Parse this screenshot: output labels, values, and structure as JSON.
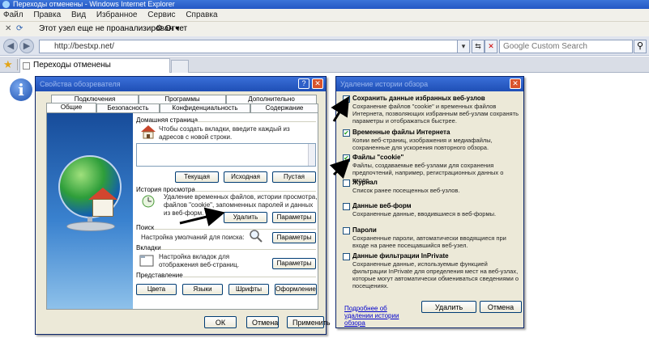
{
  "browser": {
    "window_title": "Переходы отменены - Windows Internet Explorer",
    "menu": [
      "Файл",
      "Правка",
      "Вид",
      "Избранное",
      "Сервис",
      "Справка"
    ],
    "command_bar": {
      "site_label": "Этот узел еще не проанализирован",
      "report_label": "Отчет"
    },
    "address_url": "http://bestxp.net/",
    "search_placeholder": "Google Custom Search",
    "tab_title": "Переходы отменены"
  },
  "options_dialog": {
    "title": "Свойства обозревателя",
    "tabs_row1": [
      "Подключения",
      "Программы",
      "Дополнительно"
    ],
    "tabs_row2": [
      "Общие",
      "Безопасность",
      "Конфиденциальность",
      "Содержание"
    ],
    "home": {
      "label": "Домашняя страница",
      "desc": "Чтобы создать вкладки, введите каждый из адресов с новой строки.",
      "buttons": [
        "Текущая",
        "Исходная",
        "Пустая"
      ]
    },
    "history": {
      "label": "История просмотра",
      "desc": "Удаление временных файлов, истории просмотра, файлов \"cookie\", запомненных паролей и данных из веб-форм.",
      "delete_btn": "Удалить",
      "params_btn": "Параметры"
    },
    "search": {
      "label": "Поиск",
      "desc": "Настройка умолчаний для поиска:",
      "params_btn": "Параметры"
    },
    "tabs_section": {
      "label": "Вкладки",
      "desc": "Настройка вкладок для отображения веб-страниц.",
      "params_btn": "Параметры"
    },
    "appearance": {
      "label": "Представление",
      "buttons": [
        "Цвета",
        "Языки",
        "Шрифты",
        "Оформление"
      ]
    },
    "footer": {
      "ok": "ОК",
      "cancel": "Отмена",
      "apply": "Применить"
    }
  },
  "delete_dialog": {
    "title": "Удаление истории обзора",
    "options": [
      {
        "title": "Сохранить данные избранных веб-узлов",
        "desc": "Сохранение файлов \"cookie\" и временных файлов Интернета, позволяющих избранным веб-узлам сохранять параметры и отображаться быстрее.",
        "checked": true
      },
      {
        "title": "Временные файлы Интернета",
        "desc": "Копии веб-страниц, изображения и медиафайлы, сохраненные для ускорения повторного обзора.",
        "checked": true
      },
      {
        "title": "Файлы \"cookie\"",
        "desc": "Файлы, создаваемые веб-узлами для сохранения предпочтений, например, регистрационных данных о входе.",
        "checked": true
      },
      {
        "title": "Журнал",
        "desc": "Список ранее посещенных веб-узлов.",
        "checked": false
      },
      {
        "title": "Данные веб-форм",
        "desc": "Сохраненные данные, вводившиеся в веб-формы.",
        "checked": false
      },
      {
        "title": "Пароли",
        "desc": "Сохраненные пароли, автоматически вводящиеся при входе на ранее посещавшийся веб-узел.",
        "checked": false
      },
      {
        "title": "Данные фильтрации InPrivate",
        "desc": "Сохраненные данные, используемые функцией фильтрации InPrivate для определения мест на веб-узлах, которые могут автоматически обмениваться сведениями о посещениях.",
        "checked": false
      }
    ],
    "more_link": "Подробнее об удалении истории обзора",
    "delete_btn": "Удалить",
    "cancel_btn": "Отмена"
  }
}
